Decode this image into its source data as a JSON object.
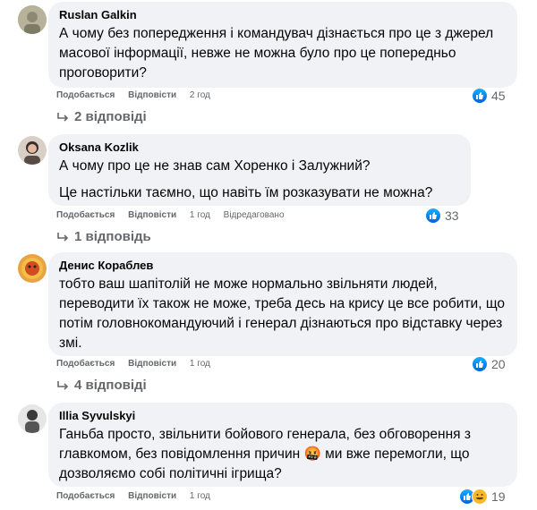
{
  "labels": {
    "like": "Подобається",
    "reply": "Відповісти"
  },
  "comments": [
    {
      "author": "Ruslan Galkin",
      "lines": [
        "А чому без попередження і командувач дізнається про це з джерел масової інформації, невже не можна було про це попередньо проговорити?"
      ],
      "time": "2 год",
      "edited": "",
      "reaction_count": "45",
      "replies": "2 відповіді"
    },
    {
      "author": "Oksana Kozlik",
      "lines": [
        "А чому про це не знав сам Хоренко і Залужний?",
        "Це настільки таємно, що навіть їм розказувати не можна?"
      ],
      "time": "1 год",
      "edited": "Відредаговано",
      "reaction_count": "33",
      "replies": "1 відповідь"
    },
    {
      "author": "Денис Кораблев",
      "lines": [
        "тобто ваш шапітолій не може нормально звільняти людей, переводити їх також не може, треба десь на крису це все робити, що потім головнокомандуючий і генерал дізнаються про відставку через змі."
      ],
      "time": "1 год",
      "edited": "",
      "reaction_count": "20",
      "replies": "4 відповіді"
    },
    {
      "author": "Illia Syvulskyi",
      "lines": [
        "Ганьба просто, звільнити бойового генерала, без обговорення з главкомом, без повідомлення причин 🤬 ми вже перемогли, що дозволяємо собі політичні ігрища?"
      ],
      "time": "1 год",
      "edited": "",
      "reaction_count": "19",
      "replies": ""
    }
  ],
  "colors": {
    "bubble": "#f0f2f5",
    "meta": "#65676b",
    "like_blue": "#0866ff"
  }
}
